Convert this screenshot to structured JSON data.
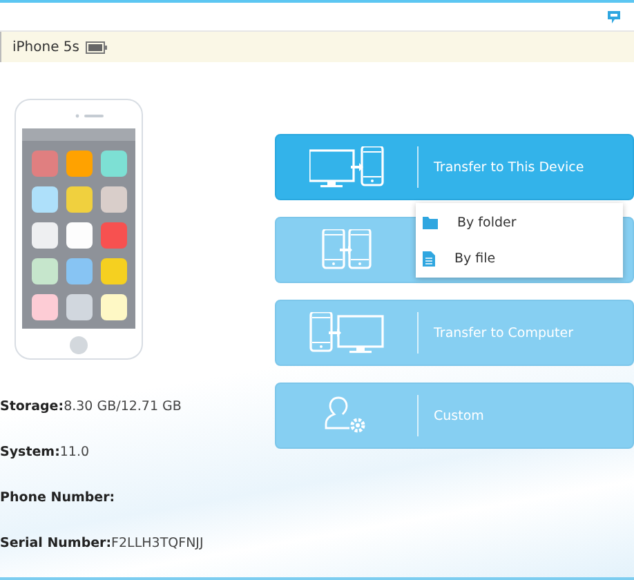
{
  "device_bar": {
    "device_name": "iPhone 5s"
  },
  "device_info": [
    {
      "label": "Storage:",
      "value": "8.30 GB/12.71 GB"
    },
    {
      "label": "System:",
      "value": "11.0"
    },
    {
      "label": "Phone Number:"
    },
    {
      "label": "Serial Number:",
      "value": "F2LLH3TQFNJJ"
    }
  ],
  "actions": [
    {
      "kind": "to-device",
      "label": "Transfer to This Device",
      "selected": true
    },
    {
      "kind": "device-to-device",
      "selected": false
    },
    {
      "kind": "to-computer",
      "label": "Transfer to Computer",
      "selected": false
    },
    {
      "kind": "custom",
      "label": "Custom",
      "selected": false
    }
  ],
  "dropdown_menu": [
    {
      "kind": "folder",
      "label": "By folder"
    },
    {
      "kind": "file",
      "label": "By file"
    }
  ]
}
